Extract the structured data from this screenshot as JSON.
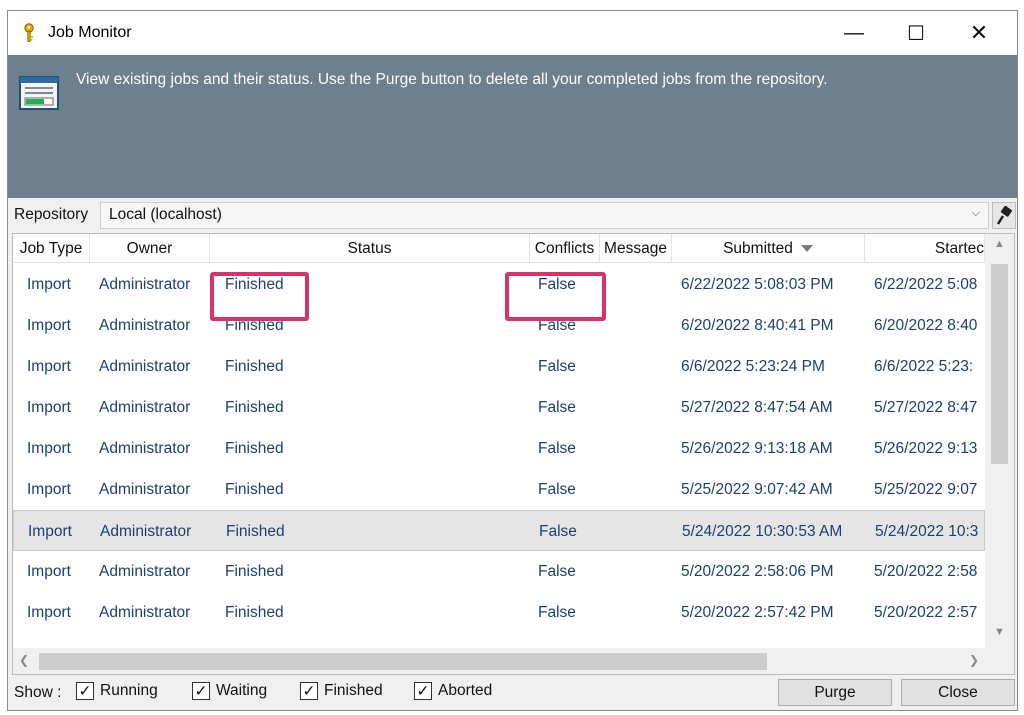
{
  "window": {
    "title": "Job Monitor",
    "controls": {
      "minimize": "—",
      "maximize": "☐",
      "close": "✕"
    }
  },
  "banner": {
    "text": "View existing jobs and their status. Use the Purge button to delete all your completed jobs from the repository."
  },
  "repository": {
    "label": "Repository",
    "value": "Local  (localhost)"
  },
  "table": {
    "columns": [
      "Job Type",
      "Owner",
      "Status",
      "Conflicts",
      "Message",
      "Submitted",
      "Startec"
    ],
    "sorted_column": "Submitted",
    "rows": [
      {
        "job_type": "Import",
        "owner": "Administrator",
        "status": "Finished",
        "conflicts": "False",
        "message": "",
        "submitted": "6/22/2022 5:08:03 PM",
        "started": "6/22/2022 5:08"
      },
      {
        "job_type": "Import",
        "owner": "Administrator",
        "status": "Finished",
        "conflicts": "False",
        "message": "",
        "submitted": "6/20/2022 8:40:41 PM",
        "started": "6/20/2022 8:40"
      },
      {
        "job_type": "Import",
        "owner": "Administrator",
        "status": "Finished",
        "conflicts": "False",
        "message": "",
        "submitted": "6/6/2022 5:23:24 PM",
        "started": "6/6/2022 5:23:"
      },
      {
        "job_type": "Import",
        "owner": "Administrator",
        "status": "Finished",
        "conflicts": "False",
        "message": "",
        "submitted": "5/27/2022 8:47:54 AM",
        "started": "5/27/2022 8:47"
      },
      {
        "job_type": "Import",
        "owner": "Administrator",
        "status": "Finished",
        "conflicts": "False",
        "message": "",
        "submitted": "5/26/2022 9:13:18 AM",
        "started": "5/26/2022 9:13"
      },
      {
        "job_type": "Import",
        "owner": "Administrator",
        "status": "Finished",
        "conflicts": "False",
        "message": "",
        "submitted": "5/25/2022 9:07:42 AM",
        "started": "5/25/2022 9:07"
      },
      {
        "job_type": "Import",
        "owner": "Administrator",
        "status": "Finished",
        "conflicts": "False",
        "message": "",
        "submitted": "5/24/2022 10:30:53 AM",
        "started": "5/24/2022 10:3"
      },
      {
        "job_type": "Import",
        "owner": "Administrator",
        "status": "Finished",
        "conflicts": "False",
        "message": "",
        "submitted": "5/20/2022 2:58:06 PM",
        "started": "5/20/2022 2:58"
      },
      {
        "job_type": "Import",
        "owner": "Administrator",
        "status": "Finished",
        "conflicts": "False",
        "message": "",
        "submitted": "5/20/2022 2:57:42 PM",
        "started": "5/20/2022 2:57"
      }
    ],
    "selected_row": 7
  },
  "footer": {
    "show_label": "Show :",
    "filters": [
      {
        "label": "Running",
        "checked": true
      },
      {
        "label": "Waiting",
        "checked": true
      },
      {
        "label": "Finished",
        "checked": true
      },
      {
        "label": "Aborted",
        "checked": true
      }
    ],
    "purge_label": "Purge",
    "close_label": "Close"
  },
  "colors": {
    "banner": "#6e7f8e",
    "cell_text": "#1d3f72",
    "highlight": "#d6336c"
  }
}
